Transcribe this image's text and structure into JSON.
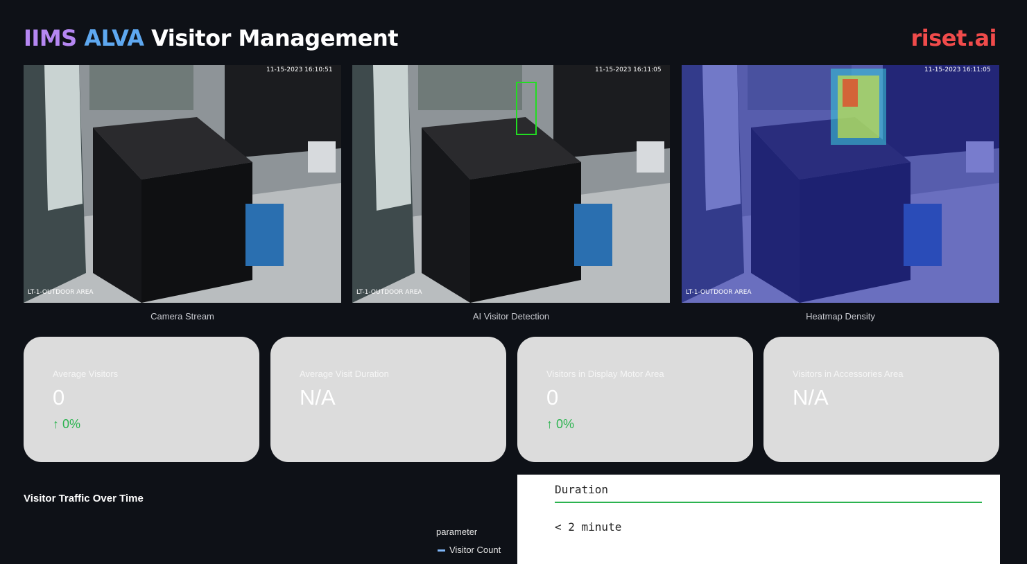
{
  "header": {
    "title_part1": "IIMS",
    "title_part2": "ALVA",
    "title_part3": "Visitor Management",
    "brand": "riset.ai"
  },
  "colors": {
    "background": "#0e1117",
    "title_part1": "#b587f2",
    "title_part2": "#5ea8f0",
    "brand": "#f04b4b",
    "positive_delta": "#2bb34f",
    "card_background": "#dcdcdc"
  },
  "cameras": [
    {
      "caption": "Camera Stream",
      "timestamp": "11-15-2023 16:10:51",
      "location": "LT-1-OUTDOOR AREA"
    },
    {
      "caption": "AI Visitor Detection",
      "timestamp": "11-15-2023 16:11:05",
      "location": "LT-1-OUTDOOR AREA"
    },
    {
      "caption": "Heatmap Density",
      "timestamp": "11-15-2023 16:11:05",
      "location": "LT-1-OUTDOOR AREA"
    }
  ],
  "metrics": [
    {
      "label": "Average Visitors",
      "value": "0",
      "delta": "0%"
    },
    {
      "label": "Average Visit Duration",
      "value": "N/A",
      "delta": ""
    },
    {
      "label": "Visitors in Display Motor Area",
      "value": "0",
      "delta": "0%"
    },
    {
      "label": "Visitors in Accessories Area",
      "value": "N/A",
      "delta": ""
    }
  ],
  "traffic": {
    "title": "Visitor Traffic Over Time",
    "legend_title": "parameter",
    "legend_item": "Visitor Count"
  },
  "duration_table": {
    "header": "Duration",
    "rows": [
      "< 2 minute"
    ]
  }
}
